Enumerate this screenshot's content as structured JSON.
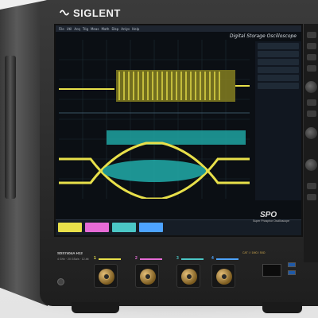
{
  "brand": {
    "name": "SIGLENT",
    "icon": "siglent-logo-icon"
  },
  "screen": {
    "title": "Digital Storage Oscilloscope",
    "menu_items": [
      "File",
      "Util",
      "Acq",
      "Trig",
      "Meas",
      "Math",
      "Disp",
      "Anlys",
      "Help"
    ],
    "status_colors": {
      "ch1": "#e8e04a",
      "ch2": "#e66bd6",
      "ch3": "#4bc7c6",
      "ch4": "#4da3ff"
    }
  },
  "badge": {
    "spo": "SPO",
    "spo_sub": "Super Phosphor Oscilloscope"
  },
  "front_panel": {
    "model": "SDS7404A H12",
    "spec": "4 GHz · 20 GSa/s · 12-bit",
    "channels": [
      {
        "label": "1",
        "color": "#e8e04a"
      },
      {
        "label": "2",
        "color": "#e66bd6"
      },
      {
        "label": "3",
        "color": "#4bc7c6"
      },
      {
        "label": "4",
        "color": "#4da3ff"
      }
    ],
    "rt_label": "CAT I / 1MΩ / 50Ω"
  },
  "colors": {
    "waveform_yellow": "#e8e04a",
    "eye_teal": "#1fa3a1",
    "screen_bg": "#0b0f14"
  }
}
